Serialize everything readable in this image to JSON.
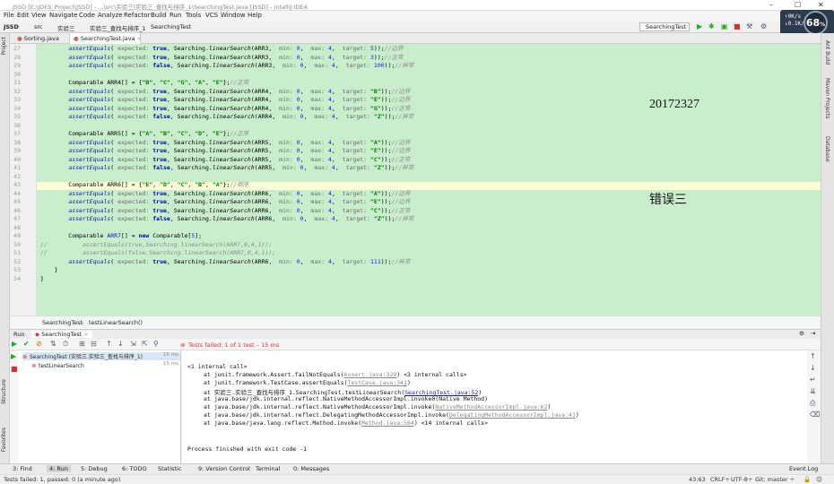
{
  "window": {
    "title": "JSSD [E:\\JDES_Project\\JSSD] - ...\\src\\实验三\\实验三_查找与排序_1\\SearchingTest.java [JSSD] - IntelliJ IDEA"
  },
  "menu": [
    "File",
    "Edit",
    "View",
    "Navigate",
    "Code",
    "Analyze",
    "Refactor",
    "Build",
    "Run",
    "Tools",
    "VCS",
    "Window",
    "Help"
  ],
  "nav": {
    "crumbs": [
      "JSSD",
      "src",
      "实验三",
      "实验三_查找与排序_1",
      "SearchingTest"
    ],
    "run_config": "SearchingTest"
  },
  "overlay": {
    "net_up": "0K/s",
    "net_down": "0.1K/s",
    "percent": "68"
  },
  "tabs": [
    {
      "label": "Sorting.java"
    },
    {
      "label": "SearchingTest.java"
    }
  ],
  "sidebar_left": [
    "Project",
    "Structure",
    "Favorites"
  ],
  "sidebar_right": [
    "Ant Build",
    "Maven Projects",
    "Database"
  ],
  "editor": {
    "line_numbers": [
      "27",
      "28",
      "29",
      "30",
      "31",
      "32",
      "33",
      "34",
      "35",
      "36",
      "37",
      "38",
      "39",
      "40",
      "41",
      "42",
      "43",
      "44",
      "45",
      "46",
      "47",
      "48",
      "49",
      "50",
      "51",
      "52",
      "53",
      "54"
    ]
  },
  "annotations": {
    "student_id": "20172327",
    "error_label": "错误三"
  },
  "breadcrumb_bottom": [
    "SearchingTest",
    "testLinearSearch()"
  ],
  "run": {
    "tab_label": "Run",
    "config_tab": "SearchingTest",
    "tests_failed": "Tests failed: 1 of 1 test – 15 ms",
    "tree_root": "SearchingTest (实验三.实验三_查找与排序_1)",
    "tree_root_time": "15 ms",
    "tree_child": "testLinearSearch",
    "tree_child_time": "15 ms"
  },
  "console": {
    "l0": "<1 internal call>",
    "l1a": "at junit.framework.Assert.failNotEquals(",
    "l1link": "Assert.java:329",
    "l1b": ") <3 internal calls>",
    "l2a": "at junit.framework.TestCase.assertEquals(",
    "l2link": "TestCase.java:341",
    "l2b": ")",
    "l3a": "at 实验三.实验三_查找与排序_1.SearchingTest.testLinearSearch(",
    "l3link": "SearchingTest.java:52",
    "l3b": ")",
    "l4": "at java.base/jdk.internal.reflect.NativeMethodAccessorImpl.invoke0(Native Method)",
    "l5a": "at java.base/jdk.internal.reflect.NativeMethodAccessorImpl.invoke(",
    "l5link": "NativeMethodAccessorImpl.java:62",
    "l5b": ")",
    "l6a": "at java.base/jdk.internal.reflect.DelegatingMethodAccessorImpl.invoke(",
    "l6link": "DelegatingMethodAccessorImpl.java:43",
    "l6b": ")",
    "l7a": "at java.base/java.lang.reflect.Method.invoke(",
    "l7link": "Method.java:564",
    "l7b": ") <14 internal calls>",
    "l8": "Process finished with exit code -1"
  },
  "bottom_tools": [
    "3: Find",
    "4: Run",
    "5: Debug",
    "6: TODO",
    "Statistic",
    "9: Version Control",
    "Terminal",
    "0: Messages",
    "Event Log"
  ],
  "status": {
    "left": "Tests failed: 1, passed: 0 (a minute ago)",
    "pos": "43:63",
    "crlf": "CRLF÷",
    "enc": "UTF-8÷",
    "git": "Git: master ÷"
  },
  "colors": {
    "editor_bg": "#c8eecb",
    "current_line": "#fcfcd6",
    "error": "#d33333"
  }
}
